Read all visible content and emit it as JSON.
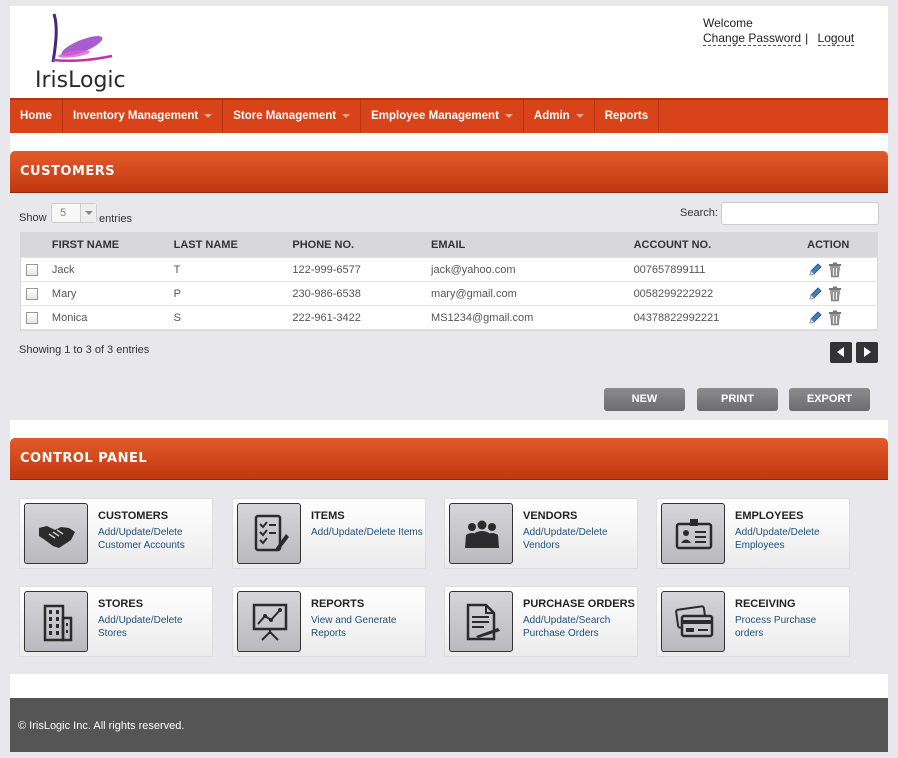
{
  "brand": {
    "name": "IrisLogic"
  },
  "user": {
    "welcome": "Welcome",
    "change_password": "Change Password",
    "separator": "|",
    "logout": "Logout"
  },
  "nav": [
    {
      "label": "Home",
      "dropdown": false
    },
    {
      "label": "Inventory Management",
      "dropdown": true
    },
    {
      "label": "Store Management",
      "dropdown": true
    },
    {
      "label": "Employee Management",
      "dropdown": true
    },
    {
      "label": "Admin",
      "dropdown": true
    },
    {
      "label": "Reports",
      "dropdown": false
    }
  ],
  "customers": {
    "title": "CUSTOMERS",
    "show_label": "Show",
    "page_length": "5",
    "entries_label": "entries",
    "search_label": "Search:",
    "columns": [
      "FIRST NAME",
      "LAST NAME",
      "PHONE NO.",
      "EMAIL",
      "ACCOUNT NO.",
      "ACTION"
    ],
    "rows": [
      {
        "first": "Jack",
        "last": "T",
        "phone": "122-999-6577",
        "email": "jack@yahoo.com",
        "account": "007657899111"
      },
      {
        "first": "Mary",
        "last": "P",
        "phone": "230-986-6538",
        "email": "mary@gmail.com",
        "account": "0058299222922"
      },
      {
        "first": "Monica",
        "last": "S",
        "phone": "222-961-3422",
        "email": "MS1234@gmail.com",
        "account": "04378822992221"
      }
    ],
    "info": "Showing 1 to 3 of 3 entries",
    "buttons": {
      "new": "NEW",
      "print": "PRINT",
      "export": "EXPORT"
    }
  },
  "control_panel": {
    "title": "CONTROL PANEL",
    "tiles": [
      {
        "title": "CUSTOMERS",
        "desc": "Add/Update/Delete Customer Accounts",
        "icon": "handshake-icon"
      },
      {
        "title": "ITEMS",
        "desc": "Add/Update/Delete Items",
        "icon": "checklist-icon"
      },
      {
        "title": "VENDORS",
        "desc": "Add/Update/Delete Vendors",
        "icon": "people-group-icon"
      },
      {
        "title": "EMPLOYEES",
        "desc": "Add/Update/Delete Employees",
        "icon": "id-badge-icon"
      },
      {
        "title": "STORES",
        "desc": "Add/Update/Delete Stores",
        "icon": "building-icon"
      },
      {
        "title": "REPORTS",
        "desc": "View and Generate Reports",
        "icon": "chart-easel-icon"
      },
      {
        "title": "PURCHASE ORDERS",
        "desc": "Add/Update/Search Purchase Orders",
        "icon": "document-pen-icon"
      },
      {
        "title": "RECEIVING",
        "desc": "Process Purchase orders",
        "icon": "credit-cards-icon"
      }
    ]
  },
  "footer": {
    "text": "© IrisLogic Inc. All rights reserved."
  },
  "colors": {
    "nav": "#d9431a",
    "panel_header": "#c13810",
    "footer": "#555555",
    "link": "#1d4f7a"
  }
}
